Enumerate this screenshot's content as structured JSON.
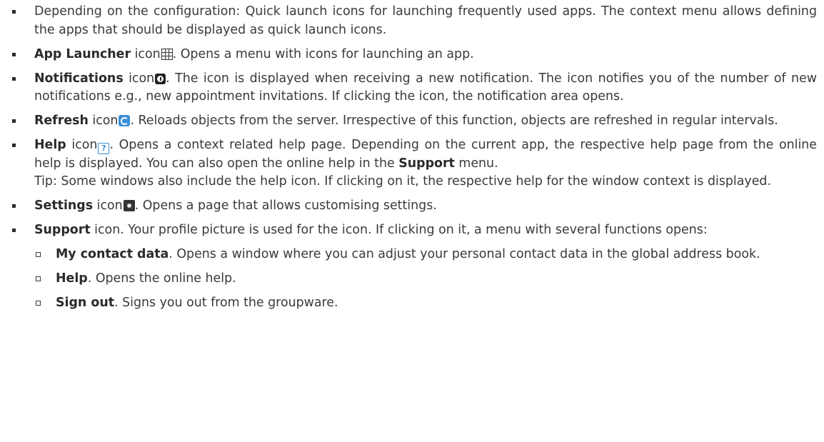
{
  "items": [
    {
      "text": "Depending on the configuration: Quick launch icons for launching frequently used apps. The context menu allows defining the apps that should be displayed as quick launch icons."
    },
    {
      "bold": "App Launcher",
      "mid": " icon",
      "icon": "app-launcher-grid-icon",
      "rest": ". Opens a menu with icons for launching an app."
    },
    {
      "bold": "Notifications",
      "mid": " icon",
      "icon": "notification-badge-icon",
      "rest": ". The icon is displayed when receiving a new notification. The icon notifies you of the number of new notifications e.g., new appointment invitations. If clicking the icon, the notification area opens."
    },
    {
      "bold": "Refresh",
      "mid": " icon",
      "icon": "refresh-icon",
      "rest": ". Reloads objects from the server. Irrespective of this function, objects are refreshed in regular intervals."
    },
    {
      "bold": "Help",
      "mid": " icon",
      "icon": "help-icon",
      "rest": ". Opens a context related help page. Depending on the current app, the respective help page from the online help is displayed. You can also open the online help in the ",
      "bold2": "Support",
      "rest2": " menu.",
      "tip": "Tip: Some windows also include the help icon. If clicking on it, the respective help for the window context is displayed."
    },
    {
      "bold": "Settings",
      "mid": " icon",
      "icon": "settings-icon",
      "rest": ". Opens a page that allows customising settings."
    },
    {
      "bold": "Support",
      "rest": " icon. Your profile picture is used for the icon. If clicking on it, a menu with several functions opens:",
      "subitems": [
        {
          "bold": "My contact data",
          "rest": ". Opens a window where you can adjust your personal contact data in the global address book."
        },
        {
          "bold": "Help",
          "rest": ". Opens the online help."
        },
        {
          "bold": "Sign out",
          "rest": ". Signs you out from the groupware."
        }
      ]
    }
  ]
}
